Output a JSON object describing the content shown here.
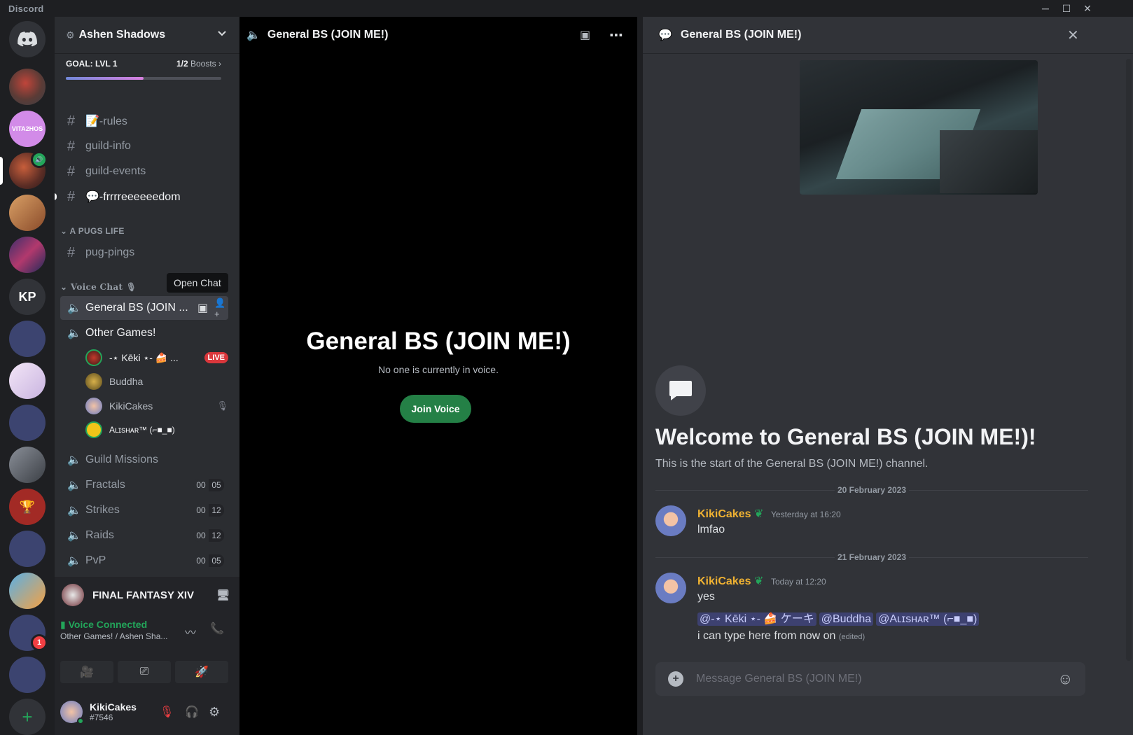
{
  "window": {
    "app_name": "Discord",
    "minimize": "─",
    "maximize": "☐",
    "close": "✕"
  },
  "rail": {
    "kp_initials": "KP",
    "badge_count": "1",
    "vita_label": "VITA2HOS"
  },
  "server": {
    "name": "Ashen Shadows",
    "boost_goal": "GOAL: LVL 1",
    "boost_count": "1/2",
    "boost_label": "Boosts",
    "boost_progress": 0.5
  },
  "channels": {
    "rules": "📝-rules",
    "guild_info": "guild-info",
    "guild_events": "guild-events",
    "freedom": "💬-frrrreeeeeedom",
    "category_pugs": "A PUGS LIFE",
    "pug_pings": "pug-pings",
    "category_voice": "Voice Chat 🎙",
    "general": "General BS (JOIN ...",
    "other_games": "Other Games!",
    "guild_missions": "Guild Missions",
    "fractals": "Fractals",
    "strikes": "Strikes",
    "raids": "Raids",
    "pvp": "PvP"
  },
  "counters": {
    "fractals": [
      "00",
      "05"
    ],
    "strikes": [
      "00",
      "12"
    ],
    "raids": [
      "00",
      "12"
    ],
    "pvp": [
      "00",
      "05"
    ]
  },
  "voice_users": {
    "keki": "-⋆ Kēki ⋆- 🍰 ...",
    "live": "LIVE",
    "buddha": "Buddha",
    "kikicakes": "KikiCakes",
    "alishar": "Aʟɪsʜᴀʀ™ (⌐■_■)"
  },
  "tooltip": "Open Chat",
  "activity": {
    "game": "FINAL FANTASY XIV"
  },
  "voice_panel": {
    "status": "Voice Connected",
    "location": "Other Games! / Ashen Sha..."
  },
  "user": {
    "name": "KikiCakes",
    "tag": "#7546"
  },
  "stage": {
    "header": "General BS (JOIN ME!)",
    "title": "General BS (JOIN ME!)",
    "subtitle": "No one is currently in voice.",
    "join_label": "Join Voice"
  },
  "chat": {
    "header": "General BS (JOIN ME!)",
    "welcome_title": "Welcome to General BS (JOIN ME!)!",
    "welcome_sub": "This is the start of the General BS (JOIN ME!) channel.",
    "date1": "20 February 2023",
    "date2": "21 February 2023",
    "msg1": {
      "author": "KikiCakes",
      "time": "Yesterday at 16:20",
      "text": "lmfao"
    },
    "msg2": {
      "author": "KikiCakes",
      "time": "Today at 12:20",
      "text": "yes",
      "mention1": "@-⋆ Kēki ⋆- 🍰 ケーキ",
      "mention2": "@Buddha",
      "mention3": "@Aʟɪsʜᴀʀ™ (⌐■_■)",
      "text2": "i can type here from now on",
      "edited": "(edited)"
    },
    "composer_placeholder": "Message General BS (JOIN ME!)"
  },
  "colors": {
    "accent": "#5865f2",
    "online": "#23a55a",
    "live": "#da373c",
    "username": "#f0b232"
  }
}
